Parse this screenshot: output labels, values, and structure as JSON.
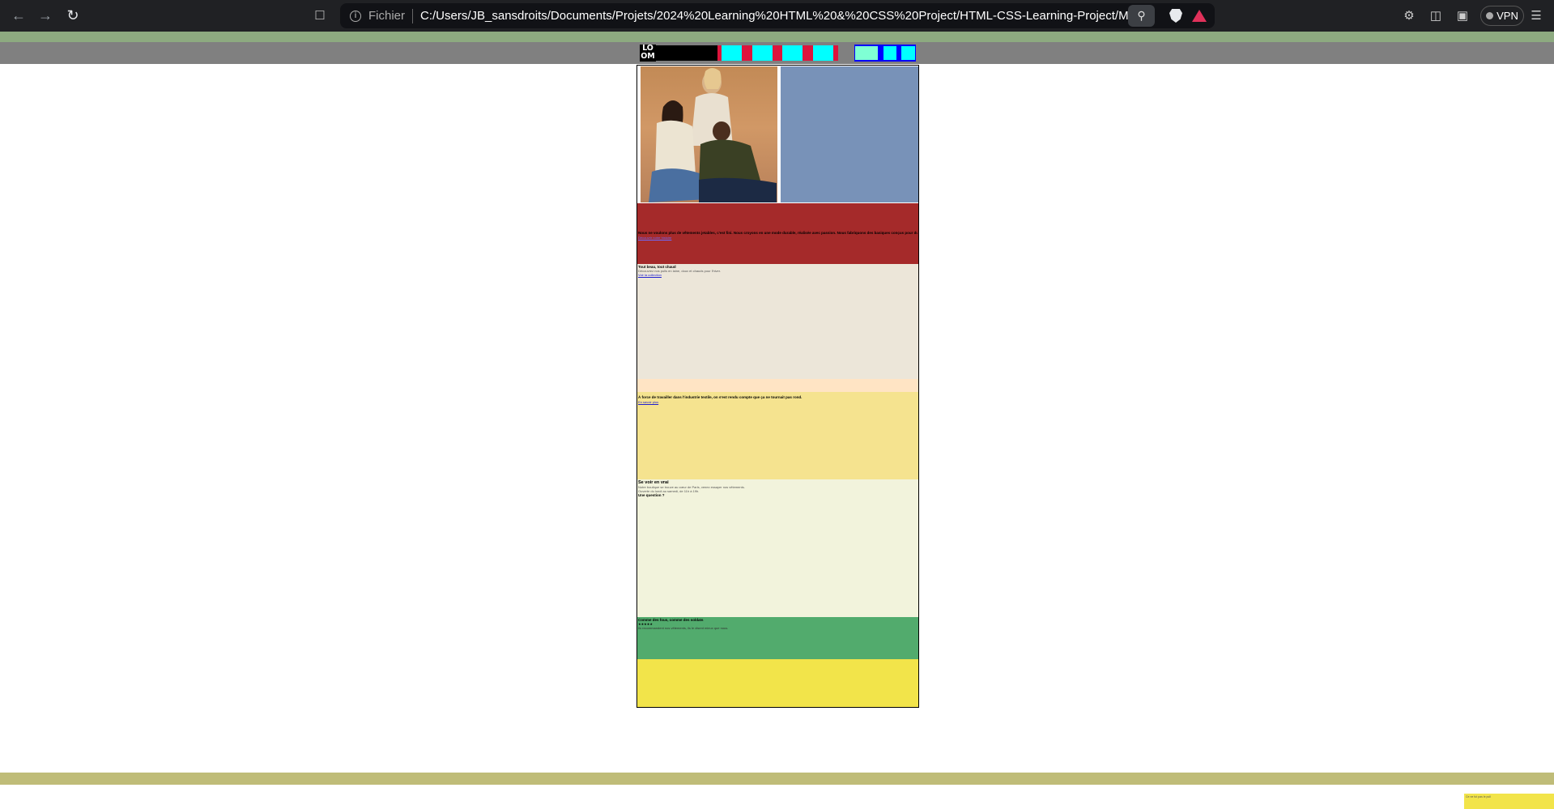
{
  "browser": {
    "site_info_label": "Fichier",
    "url": "C:/Users/JB_sansdroits/Documents/Projets/2024%20Learning%20HTML%20&%20CSS%20Project/HTML-CSS-Learning-Project/Model%201/...",
    "vpn_label": "VPN"
  },
  "header": {
    "logo_line1": "LO",
    "logo_line2": "OM"
  },
  "sections": {
    "red": {
      "text": "Nous ne voulons plus de vêtements jetables, c'est fini. Nous croyons en une mode durable, réalisée avec passion. Nous fabriquons des basiques conçus pour durer, à partir de matériaux choisis avec soin.",
      "link": "Découvrir notre histoire"
    },
    "beige": {
      "title": "Tout beau, tout chaud",
      "text": "Découvrez nos pulls en laine, doux et chauds pour l'hiver.",
      "link": "Voir la collection"
    },
    "yellow": {
      "text": "À force de travailler dans l'industrie textile, on s'est rendu compte que ça ne tournait pas rond.",
      "link": "En savoir plus"
    },
    "cream": {
      "title": "Se voir en vrai",
      "text1": "Notre boutique se trouve au cœur de Paris, venez essayer nos vêtements.",
      "text2": "Ouverte du lundi au samedi, de 11h à 19h.",
      "question": "Une question ?"
    },
    "green": {
      "title": "Comme des fous, comme des soldats",
      "stars": "★★★★★",
      "text": "Ils recommandent nos vêtements, ils le disent mieux que nous."
    }
  },
  "footer": {
    "note": "Ce ne fut pas le pull"
  }
}
